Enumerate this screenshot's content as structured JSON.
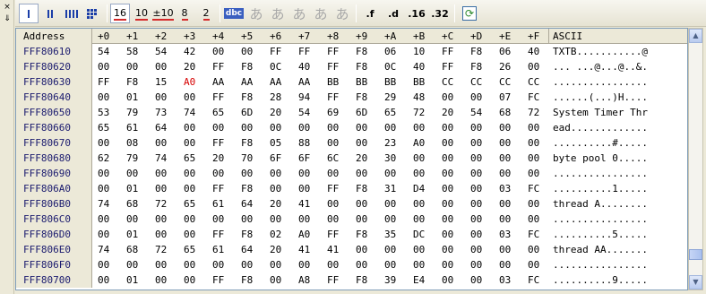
{
  "window_buttons": {
    "close": "×",
    "pin": "⇓"
  },
  "toolbar": {
    "num_buttons": [
      "16",
      "10",
      "±10",
      "8",
      "2"
    ],
    "dbc_label": "dbc",
    "jp_glyph": "あ",
    "fmt_buttons": [
      ".f",
      ".d",
      ".16",
      ".32"
    ],
    "refresh_glyph": "⟳"
  },
  "header": {
    "address": "Address",
    "offsets": [
      "+0",
      "+1",
      "+2",
      "+3",
      "+4",
      "+5",
      "+6",
      "+7",
      "+8",
      "+9",
      "+A",
      "+B",
      "+C",
      "+D",
      "+E",
      "+F"
    ],
    "ascii": "ASCII"
  },
  "rows": [
    {
      "address": "FFF80610",
      "bytes": [
        "54",
        "58",
        "54",
        "42",
        "00",
        "00",
        "FF",
        "FF",
        "FF",
        "F8",
        "06",
        "10",
        "FF",
        "F8",
        "06",
        "40"
      ],
      "ascii": "TXTB...........@"
    },
    {
      "address": "FFF80620",
      "bytes": [
        "00",
        "00",
        "00",
        "20",
        "FF",
        "F8",
        "0C",
        "40",
        "FF",
        "F8",
        "0C",
        "40",
        "FF",
        "F8",
        "26",
        "00"
      ],
      "ascii": "... ...@...@..&."
    },
    {
      "address": "FFF80630",
      "bytes": [
        "FF",
        "F8",
        "15",
        "A0",
        "AA",
        "AA",
        "AA",
        "AA",
        "BB",
        "BB",
        "BB",
        "BB",
        "CC",
        "CC",
        "CC",
        "CC"
      ],
      "ascii": "................"
    },
    {
      "address": "FFF80640",
      "bytes": [
        "00",
        "01",
        "00",
        "00",
        "FF",
        "F8",
        "28",
        "94",
        "FF",
        "F8",
        "29",
        "48",
        "00",
        "00",
        "07",
        "FC"
      ],
      "ascii": "......(...)H...."
    },
    {
      "address": "FFF80650",
      "bytes": [
        "53",
        "79",
        "73",
        "74",
        "65",
        "6D",
        "20",
        "54",
        "69",
        "6D",
        "65",
        "72",
        "20",
        "54",
        "68",
        "72"
      ],
      "ascii": "System Timer Thr"
    },
    {
      "address": "FFF80660",
      "bytes": [
        "65",
        "61",
        "64",
        "00",
        "00",
        "00",
        "00",
        "00",
        "00",
        "00",
        "00",
        "00",
        "00",
        "00",
        "00",
        "00"
      ],
      "ascii": "ead............."
    },
    {
      "address": "FFF80670",
      "bytes": [
        "00",
        "08",
        "00",
        "00",
        "FF",
        "F8",
        "05",
        "88",
        "00",
        "00",
        "23",
        "A0",
        "00",
        "00",
        "00",
        "00"
      ],
      "ascii": "..........#....."
    },
    {
      "address": "FFF80680",
      "bytes": [
        "62",
        "79",
        "74",
        "65",
        "20",
        "70",
        "6F",
        "6F",
        "6C",
        "20",
        "30",
        "00",
        "00",
        "00",
        "00",
        "00"
      ],
      "ascii": "byte pool 0....."
    },
    {
      "address": "FFF80690",
      "bytes": [
        "00",
        "00",
        "00",
        "00",
        "00",
        "00",
        "00",
        "00",
        "00",
        "00",
        "00",
        "00",
        "00",
        "00",
        "00",
        "00"
      ],
      "ascii": "................"
    },
    {
      "address": "FFF806A0",
      "bytes": [
        "00",
        "01",
        "00",
        "00",
        "FF",
        "F8",
        "00",
        "00",
        "FF",
        "F8",
        "31",
        "D4",
        "00",
        "00",
        "03",
        "FC"
      ],
      "ascii": "..........1....."
    },
    {
      "address": "FFF806B0",
      "bytes": [
        "74",
        "68",
        "72",
        "65",
        "61",
        "64",
        "20",
        "41",
        "00",
        "00",
        "00",
        "00",
        "00",
        "00",
        "00",
        "00"
      ],
      "ascii": "thread A........"
    },
    {
      "address": "FFF806C0",
      "bytes": [
        "00",
        "00",
        "00",
        "00",
        "00",
        "00",
        "00",
        "00",
        "00",
        "00",
        "00",
        "00",
        "00",
        "00",
        "00",
        "00"
      ],
      "ascii": "................"
    },
    {
      "address": "FFF806D0",
      "bytes": [
        "00",
        "01",
        "00",
        "00",
        "FF",
        "F8",
        "02",
        "A0",
        "FF",
        "F8",
        "35",
        "DC",
        "00",
        "00",
        "03",
        "FC"
      ],
      "ascii": "..........5....."
    },
    {
      "address": "FFF806E0",
      "bytes": [
        "74",
        "68",
        "72",
        "65",
        "61",
        "64",
        "20",
        "41",
        "41",
        "00",
        "00",
        "00",
        "00",
        "00",
        "00",
        "00"
      ],
      "ascii": "thread AA......."
    },
    {
      "address": "FFF806F0",
      "bytes": [
        "00",
        "00",
        "00",
        "00",
        "00",
        "00",
        "00",
        "00",
        "00",
        "00",
        "00",
        "00",
        "00",
        "00",
        "00",
        "00"
      ],
      "ascii": "................"
    },
    {
      "address": "FFF80700",
      "bytes": [
        "00",
        "01",
        "00",
        "00",
        "FF",
        "F8",
        "00",
        "A8",
        "FF",
        "F8",
        "39",
        "E4",
        "00",
        "00",
        "03",
        "FC"
      ],
      "ascii": "..........9....."
    }
  ],
  "highlight": {
    "row": 2,
    "byte": 3
  },
  "colors": {
    "highlight": "#d60000",
    "address_text": "#1a1a6e"
  },
  "scrollbar": {
    "up": "▲",
    "down": "▼",
    "position": 0.93
  }
}
